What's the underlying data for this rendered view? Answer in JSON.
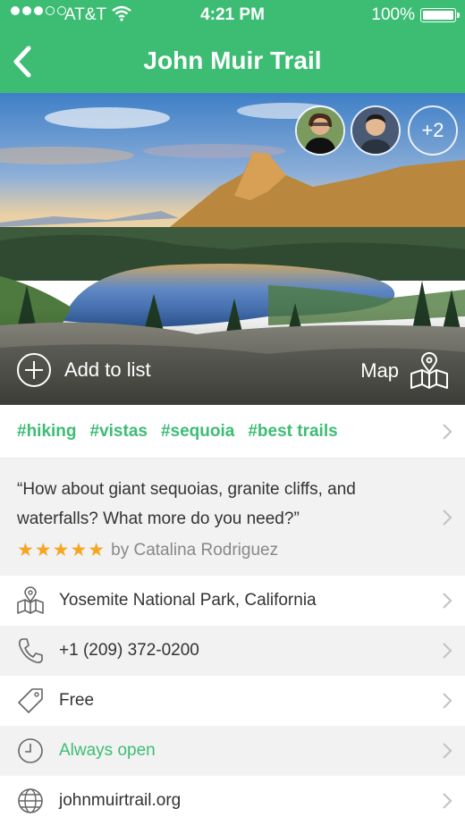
{
  "status": {
    "carrier": "AT&T",
    "time": "4:21 PM",
    "battery": "100%"
  },
  "header": {
    "title": "John Muir Trail"
  },
  "hero": {
    "more_count": "+2",
    "add_label": "Add to list",
    "map_label": "Map"
  },
  "tags": [
    "#hiking",
    "#vistas",
    "#sequoia",
    "#best trails"
  ],
  "review": {
    "quote": "“How about giant sequoias, granite cliffs, and waterfalls? What more do you need?”",
    "stars": "★★★★★",
    "author": "by Catalina Rodriguez"
  },
  "info": [
    {
      "icon": "map-icon",
      "label": "Yosemite National Park, California"
    },
    {
      "icon": "phone-icon",
      "label": "+1 (209) 372-0200"
    },
    {
      "icon": "price-tag-icon",
      "label": "Free"
    },
    {
      "icon": "clock-icon",
      "label": "Always open"
    },
    {
      "icon": "globe-icon",
      "label": "johnmuirtrail.org"
    }
  ],
  "colors": {
    "brand": "#3dbd74",
    "star": "#f5a623",
    "row_alt": "#f2f2f2"
  }
}
